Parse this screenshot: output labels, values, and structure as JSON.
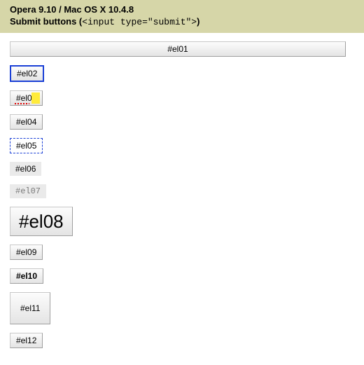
{
  "header": {
    "title": "Opera 9.10 / Mac OS X 10.4.8",
    "subtitle_prefix": "Submit buttons (",
    "subtitle_code": "<input type=\"submit\">",
    "subtitle_suffix": ")"
  },
  "buttons": {
    "el01": "#el01",
    "el02": "#el02",
    "el03": "#el03",
    "el04": "#el04",
    "el05": "#el05",
    "el06": "#el06",
    "el07": "#el07",
    "el08": "#el08",
    "el09": "#el09",
    "el10": "#el10",
    "el11": "#el11",
    "el12": "#el12"
  }
}
